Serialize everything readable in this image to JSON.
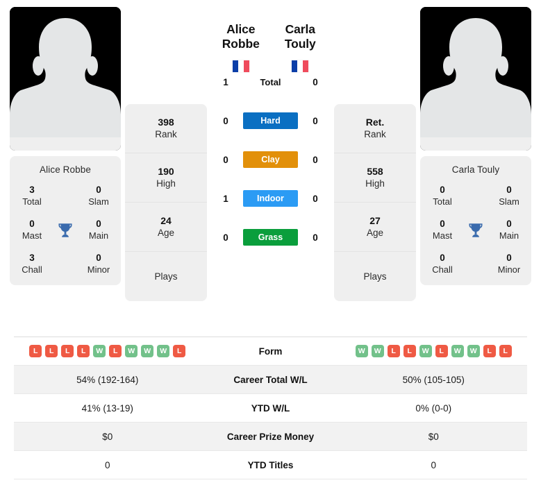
{
  "players": {
    "left": {
      "name": "Alice Robbe",
      "card_name": "Alice Robbe",
      "country_flag": "fr-flag-icon",
      "flag_colors": [
        "#0B3EA8",
        "#FFFFFF",
        "#EF4B5C"
      ],
      "avatar": "player-avatar-silhouette",
      "titles": {
        "total_value": "3",
        "total_label": "Total",
        "slam_value": "0",
        "slam_label": "Slam",
        "mast_value": "0",
        "mast_label": "Mast",
        "main_value": "0",
        "main_label": "Main",
        "chall_value": "3",
        "chall_label": "Chall",
        "minor_value": "0",
        "minor_label": "Minor"
      },
      "rank_value": "398",
      "rank_label": "Rank",
      "high_value": "190",
      "high_label": "High",
      "age_value": "24",
      "age_label": "Age",
      "plays_value": "",
      "plays_label": "Plays"
    },
    "right": {
      "name": "Carla Touly",
      "card_name": "Carla Touly",
      "country_flag": "fr-flag-icon",
      "flag_colors": [
        "#0B3EA8",
        "#FFFFFF",
        "#EF4B5C"
      ],
      "avatar": "player-avatar-silhouette",
      "titles": {
        "total_value": "0",
        "total_label": "Total",
        "slam_value": "0",
        "slam_label": "Slam",
        "mast_value": "0",
        "mast_label": "Mast",
        "main_value": "0",
        "main_label": "Main",
        "chall_value": "0",
        "chall_label": "Chall",
        "minor_value": "0",
        "minor_label": "Minor"
      },
      "rank_value": "Ret.",
      "rank_label": "Rank",
      "high_value": "558",
      "high_label": "High",
      "age_value": "27",
      "age_label": "Age",
      "plays_value": "",
      "plays_label": "Plays"
    }
  },
  "head_to_head": {
    "rows": [
      {
        "label": "Total",
        "left": "1",
        "right": "0",
        "color": "transparent",
        "text_color": "#111111",
        "plain": true
      },
      {
        "label": "Hard",
        "left": "0",
        "right": "0",
        "color": "#0A6FC2",
        "text_color": "#FFFFFF",
        "plain": false
      },
      {
        "label": "Clay",
        "left": "0",
        "right": "0",
        "color": "#E2900A",
        "text_color": "#FFFFFF",
        "plain": false
      },
      {
        "label": "Indoor",
        "left": "1",
        "right": "0",
        "color": "#2B9BF4",
        "text_color": "#FFFFFF",
        "plain": false
      },
      {
        "label": "Grass",
        "left": "0",
        "right": "0",
        "color": "#0A9E3C",
        "text_color": "#FFFFFF",
        "plain": false
      }
    ]
  },
  "comparison_table": {
    "rows": [
      {
        "label": "Form",
        "type": "form",
        "left_form": [
          "L",
          "L",
          "L",
          "L",
          "W",
          "L",
          "W",
          "W",
          "W",
          "L"
        ],
        "right_form": [
          "W",
          "W",
          "L",
          "L",
          "W",
          "L",
          "W",
          "W",
          "L",
          "L"
        ],
        "left": "",
        "right": ""
      },
      {
        "label": "Career Total W/L",
        "type": "text",
        "left": "54% (192-164)",
        "right": "50% (105-105)"
      },
      {
        "label": "YTD W/L",
        "type": "text",
        "left": "41% (13-19)",
        "right": "0% (0-0)"
      },
      {
        "label": "Career Prize Money",
        "type": "text",
        "left": "$0",
        "right": "$0"
      },
      {
        "label": "YTD Titles",
        "type": "text",
        "left": "0",
        "right": "0"
      }
    ]
  },
  "theme": {
    "card_bg": "#EFEFEF",
    "win_color": "#72C18A",
    "loss_color": "#EF5A44",
    "trophy_color": "#3A6BAD"
  }
}
